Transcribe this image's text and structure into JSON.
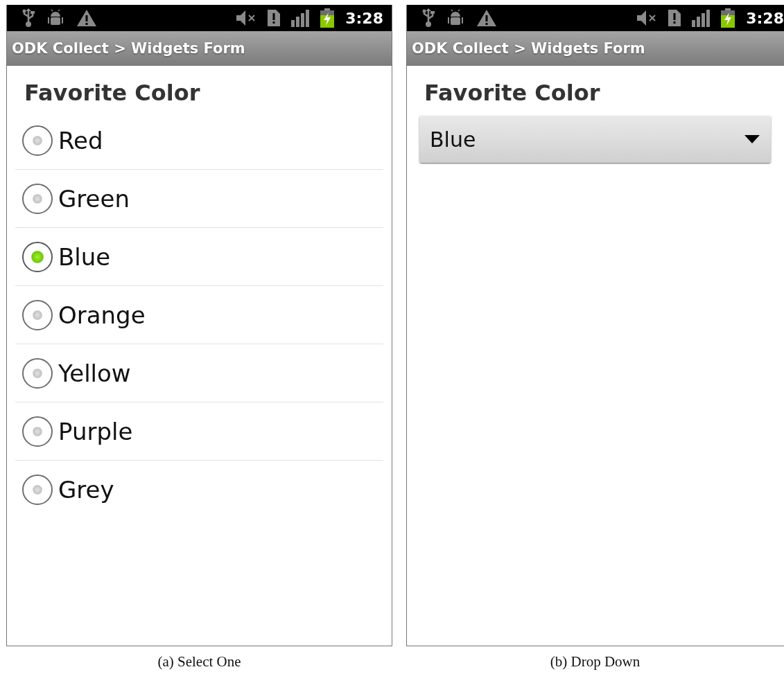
{
  "screens": [
    {
      "kind": "select_one",
      "status_bar": {
        "time": "3:28"
      },
      "title": "ODK Collect > Widgets Form",
      "question": "Favorite Color",
      "options": [
        {
          "label": "Red",
          "selected": false
        },
        {
          "label": "Green",
          "selected": false
        },
        {
          "label": "Blue",
          "selected": true
        },
        {
          "label": "Orange",
          "selected": false
        },
        {
          "label": "Yellow",
          "selected": false
        },
        {
          "label": "Purple",
          "selected": false
        },
        {
          "label": "Grey",
          "selected": false
        }
      ],
      "caption": "(a) Select One"
    },
    {
      "kind": "dropdown",
      "status_bar": {
        "time": "3:28"
      },
      "title": "ODK Collect > Widgets Form",
      "question": "Favorite Color",
      "dropdown": {
        "value": "Blue"
      },
      "caption": "(b) Drop Down"
    }
  ]
}
